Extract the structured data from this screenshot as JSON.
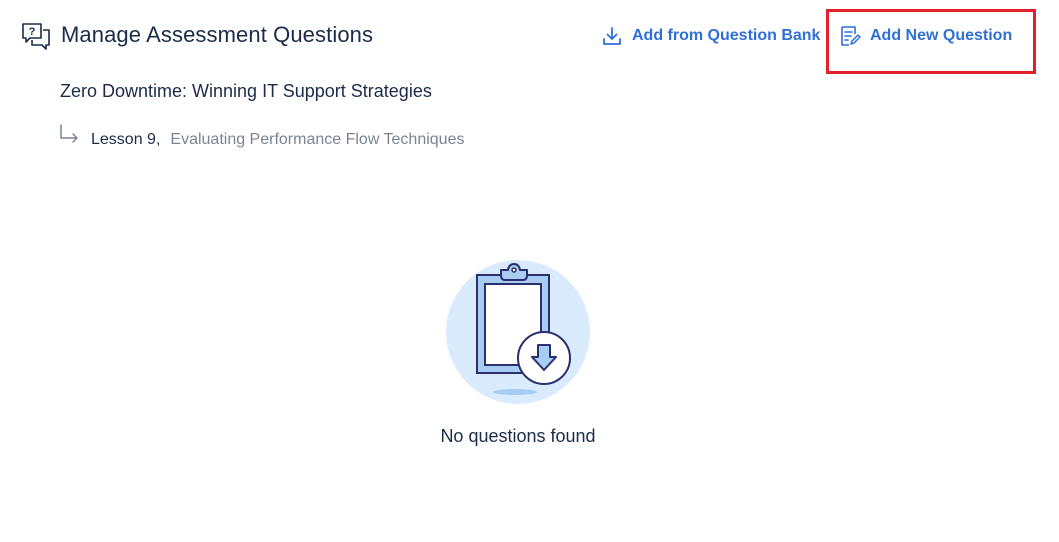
{
  "header": {
    "title": "Manage Assessment Questions",
    "icon": "question-chat-icon"
  },
  "actions": {
    "add_from_bank": {
      "label": "Add from Question Bank",
      "icon": "download-icon"
    },
    "add_new": {
      "label": "Add New Question",
      "icon": "edit-document-icon"
    }
  },
  "course": {
    "title": "Zero Downtime: Winning IT Support Strategies"
  },
  "lesson": {
    "number_label": "Lesson 9,",
    "name": "Evaluating Performance Flow Techniques"
  },
  "empty_state": {
    "message": "No questions found",
    "icon": "clipboard-download-icon"
  },
  "colors": {
    "accent": "#2f6fd6",
    "highlight": "#e0202a",
    "title": "#1c2b4a",
    "muted": "#7a8496"
  }
}
